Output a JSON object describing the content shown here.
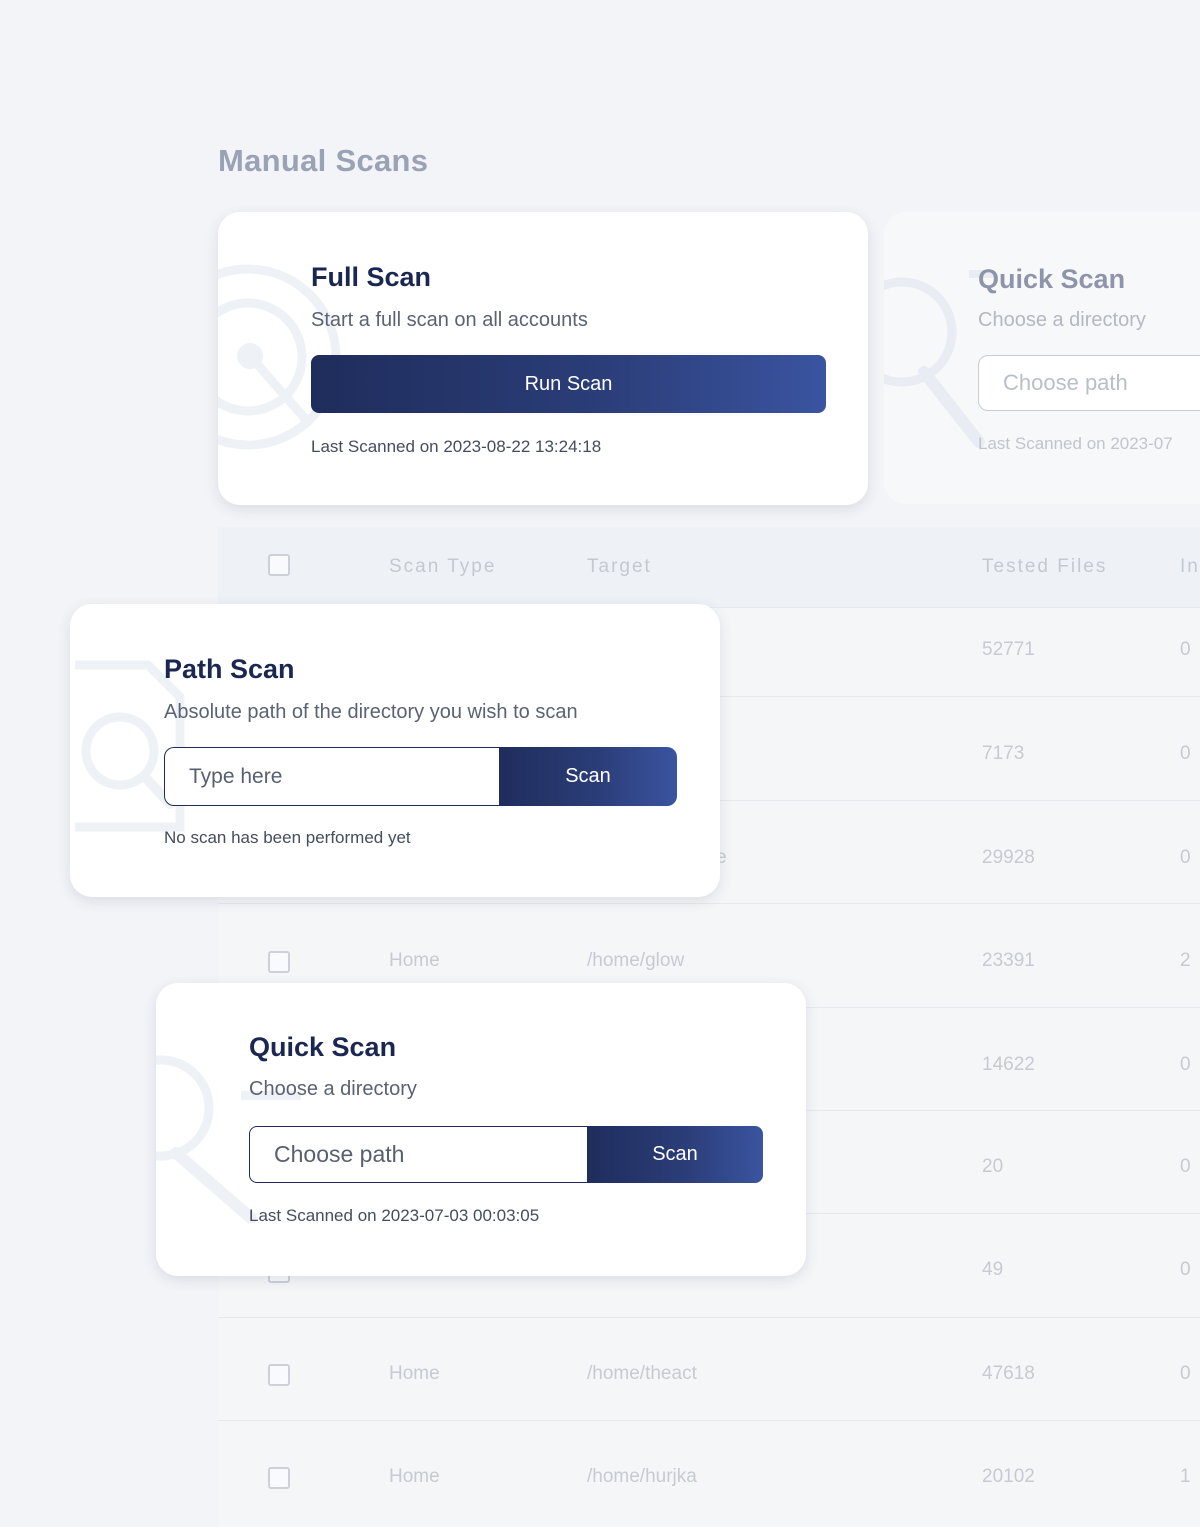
{
  "page": {
    "title": "Manual Scans"
  },
  "full_scan": {
    "title": "Full Scan",
    "subtitle": "Start a full scan on all accounts",
    "button_label": "Run Scan",
    "last_scanned": "Last Scanned on 2023-08-22 13:24:18"
  },
  "quick_scan_faded": {
    "title": "Quick Scan",
    "subtitle": "Choose a directory",
    "input_placeholder": "Choose path",
    "last_scanned": "Last Scanned on 2023-07"
  },
  "path_scan": {
    "title": "Path Scan",
    "subtitle": "Absolute path of the directory you wish to scan",
    "input_placeholder": "Type here",
    "button_label": "Scan",
    "status": "No scan has been performed yet"
  },
  "quick_scan": {
    "title": "Quick Scan",
    "subtitle": "Choose a directory",
    "input_placeholder": "Choose path",
    "button_label": "Scan",
    "last_scanned": "Last Scanned on 2023-07-03 00:03:05"
  },
  "table": {
    "headers": {
      "scan_type": "Scan Type",
      "target": "Target",
      "tested_files": "Tested Files",
      "infected_partial": "In"
    },
    "rows": [
      {
        "scan_type": "",
        "target": "",
        "tested_files": "52771",
        "infected": "0"
      },
      {
        "scan_type": "",
        "target": "",
        "tested_files": "7173",
        "infected": "0"
      },
      {
        "scan_type": "",
        "target": "e",
        "tested_files": "29928",
        "infected": "0"
      },
      {
        "scan_type": "Home",
        "target": "/home/glow",
        "tested_files": "23391",
        "infected": "2"
      },
      {
        "scan_type": "",
        "target": "",
        "tested_files": "14622",
        "infected": "0"
      },
      {
        "scan_type": "",
        "target": "",
        "tested_files": "20",
        "infected": "0"
      },
      {
        "scan_type": "",
        "target": "",
        "tested_files": "49",
        "infected": "0"
      },
      {
        "scan_type": "Home",
        "target": "/home/theact",
        "tested_files": "47618",
        "infected": "0"
      },
      {
        "scan_type": "Home",
        "target": "/home/hurjka",
        "tested_files": "20102",
        "infected": "1"
      }
    ]
  }
}
